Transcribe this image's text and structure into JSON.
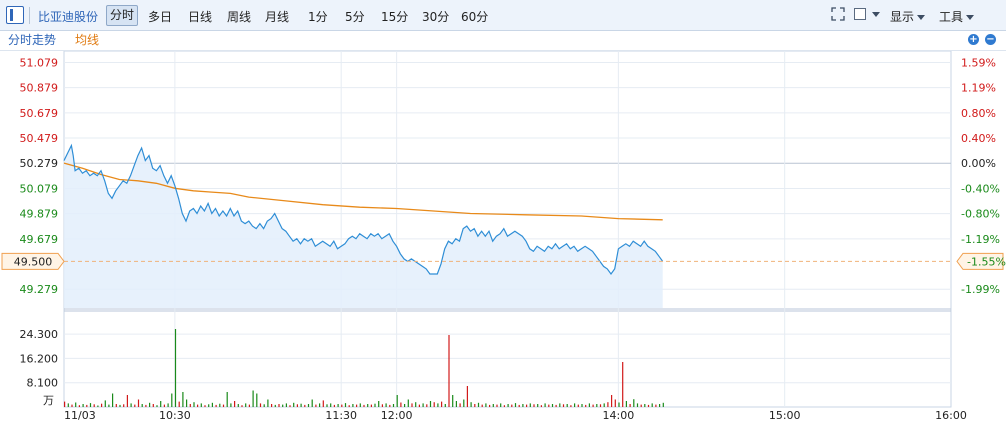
{
  "toolbar": {
    "stock_name": "比亚迪股份",
    "tabs": [
      "分时",
      "多日",
      "日线",
      "周线",
      "月线",
      "1分",
      "5分",
      "15分",
      "30分",
      "60分"
    ],
    "active_tab": "分时",
    "display_label": "显示",
    "tools_label": "工具"
  },
  "subheader": {
    "intraday_label": "分时走势",
    "avg_label": "均线"
  },
  "colors": {
    "price_line": "#2f8ed6",
    "avg_line": "#e88a1a",
    "up": "#d11a1a",
    "down": "#1a8a1a",
    "neutral": "#222222",
    "grid": "#e6ecf3"
  },
  "chart_data": {
    "type": "line",
    "prev_close": 50.279,
    "current": {
      "price": "49.500",
      "pct": "-1.55%"
    },
    "price_ticks": [
      "51.079",
      "50.879",
      "50.679",
      "50.479",
      "50.279",
      "50.079",
      "49.879",
      "49.679",
      "49.279"
    ],
    "pct_ticks": [
      "1.59%",
      "1.19%",
      "0.80%",
      "0.40%",
      "0.00%",
      "-0.40%",
      "-0.80%",
      "-1.19%",
      "-1.99%"
    ],
    "ylim": [
      49.13,
      51.17
    ],
    "time_labels": [
      "11/03",
      "10:30",
      "11:30",
      "12:00",
      "14:00",
      "15:00",
      "16:00"
    ],
    "time_minutes": [
      0,
      60,
      150,
      180,
      300,
      390,
      480
    ],
    "minutes_total": 480,
    "session_end_minute": 390,
    "price_series": [
      [
        0,
        50.3
      ],
      [
        2,
        50.36
      ],
      [
        4,
        50.42
      ],
      [
        5,
        50.34
      ],
      [
        6,
        50.22
      ],
      [
        8,
        50.24
      ],
      [
        10,
        50.2
      ],
      [
        12,
        50.22
      ],
      [
        14,
        50.18
      ],
      [
        16,
        50.2
      ],
      [
        18,
        50.18
      ],
      [
        20,
        50.22
      ],
      [
        22,
        50.14
      ],
      [
        24,
        50.04
      ],
      [
        26,
        50.0
      ],
      [
        28,
        50.06
      ],
      [
        30,
        50.1
      ],
      [
        32,
        50.14
      ],
      [
        34,
        50.12
      ],
      [
        36,
        50.18
      ],
      [
        38,
        50.26
      ],
      [
        40,
        50.34
      ],
      [
        42,
        50.4
      ],
      [
        44,
        50.3
      ],
      [
        46,
        50.34
      ],
      [
        48,
        50.24
      ],
      [
        50,
        50.22
      ],
      [
        52,
        50.26
      ],
      [
        54,
        50.18
      ],
      [
        56,
        50.12
      ],
      [
        58,
        50.18
      ],
      [
        60,
        50.1
      ],
      [
        62,
        50.0
      ],
      [
        64,
        49.88
      ],
      [
        66,
        49.82
      ],
      [
        68,
        49.9
      ],
      [
        70,
        49.92
      ],
      [
        72,
        49.88
      ],
      [
        74,
        49.94
      ],
      [
        76,
        49.9
      ],
      [
        78,
        49.96
      ],
      [
        80,
        49.88
      ],
      [
        82,
        49.92
      ],
      [
        84,
        49.86
      ],
      [
        86,
        49.9
      ],
      [
        88,
        49.86
      ],
      [
        90,
        49.92
      ],
      [
        92,
        49.86
      ],
      [
        94,
        49.9
      ],
      [
        96,
        49.82
      ],
      [
        98,
        49.8
      ],
      [
        100,
        49.82
      ],
      [
        102,
        49.78
      ],
      [
        104,
        49.76
      ],
      [
        106,
        49.8
      ],
      [
        108,
        49.76
      ],
      [
        110,
        49.82
      ],
      [
        112,
        49.84
      ],
      [
        114,
        49.88
      ],
      [
        116,
        49.82
      ],
      [
        118,
        49.76
      ],
      [
        120,
        49.74
      ],
      [
        122,
        49.7
      ],
      [
        124,
        49.66
      ],
      [
        126,
        49.68
      ],
      [
        128,
        49.64
      ],
      [
        130,
        49.68
      ],
      [
        132,
        49.66
      ],
      [
        134,
        49.68
      ],
      [
        136,
        49.62
      ],
      [
        138,
        49.64
      ],
      [
        140,
        49.66
      ],
      [
        142,
        49.64
      ],
      [
        144,
        49.62
      ],
      [
        146,
        49.66
      ],
      [
        148,
        49.6
      ],
      [
        150,
        49.62
      ],
      [
        152,
        49.64
      ],
      [
        154,
        49.68
      ],
      [
        156,
        49.7
      ],
      [
        158,
        49.68
      ],
      [
        160,
        49.72
      ],
      [
        162,
        49.7
      ],
      [
        164,
        49.68
      ],
      [
        166,
        49.72
      ],
      [
        168,
        49.7
      ],
      [
        170,
        49.72
      ],
      [
        172,
        49.68
      ],
      [
        174,
        49.7
      ],
      [
        176,
        49.72
      ],
      [
        178,
        49.66
      ],
      [
        180,
        49.62
      ],
      [
        182,
        49.56
      ],
      [
        184,
        49.52
      ],
      [
        186,
        49.5
      ],
      [
        188,
        49.52
      ],
      [
        190,
        49.5
      ],
      [
        192,
        49.48
      ],
      [
        194,
        49.46
      ],
      [
        196,
        49.44
      ],
      [
        198,
        49.4
      ],
      [
        200,
        49.4
      ],
      [
        202,
        49.4
      ],
      [
        204,
        49.48
      ],
      [
        206,
        49.6
      ],
      [
        208,
        49.66
      ],
      [
        210,
        49.64
      ],
      [
        212,
        49.68
      ],
      [
        214,
        49.66
      ],
      [
        216,
        49.76
      ],
      [
        218,
        49.78
      ],
      [
        220,
        49.74
      ],
      [
        222,
        49.76
      ],
      [
        224,
        49.7
      ],
      [
        226,
        49.74
      ],
      [
        228,
        49.7
      ],
      [
        230,
        49.74
      ],
      [
        232,
        49.66
      ],
      [
        234,
        49.7
      ],
      [
        236,
        49.72
      ],
      [
        238,
        49.76
      ],
      [
        240,
        49.7
      ],
      [
        242,
        49.72
      ],
      [
        244,
        49.74
      ],
      [
        246,
        49.72
      ],
      [
        248,
        49.7
      ],
      [
        250,
        49.66
      ],
      [
        252,
        49.6
      ],
      [
        254,
        49.58
      ],
      [
        256,
        49.62
      ],
      [
        258,
        49.6
      ],
      [
        260,
        49.58
      ],
      [
        262,
        49.62
      ],
      [
        264,
        49.6
      ],
      [
        266,
        49.64
      ],
      [
        268,
        49.6
      ],
      [
        270,
        49.62
      ],
      [
        272,
        49.64
      ],
      [
        274,
        49.6
      ],
      [
        276,
        49.62
      ],
      [
        278,
        49.58
      ],
      [
        280,
        49.6
      ],
      [
        282,
        49.62
      ],
      [
        284,
        49.6
      ],
      [
        286,
        49.58
      ],
      [
        288,
        49.54
      ],
      [
        290,
        49.5
      ],
      [
        292,
        49.46
      ],
      [
        294,
        49.44
      ],
      [
        296,
        49.4
      ],
      [
        298,
        49.44
      ],
      [
        300,
        49.6
      ],
      [
        302,
        49.62
      ],
      [
        304,
        49.64
      ],
      [
        306,
        49.62
      ],
      [
        308,
        49.66
      ],
      [
        310,
        49.64
      ],
      [
        312,
        49.62
      ],
      [
        314,
        49.66
      ],
      [
        316,
        49.62
      ],
      [
        318,
        49.6
      ],
      [
        320,
        49.58
      ],
      [
        322,
        49.54
      ],
      [
        324,
        49.5
      ]
    ],
    "avg_series": [
      [
        0,
        50.28
      ],
      [
        10,
        50.24
      ],
      [
        20,
        50.19
      ],
      [
        30,
        50.15
      ],
      [
        40,
        50.14
      ],
      [
        50,
        50.12
      ],
      [
        60,
        50.08
      ],
      [
        70,
        50.06
      ],
      [
        80,
        50.05
      ],
      [
        90,
        50.04
      ],
      [
        100,
        50.01
      ],
      [
        120,
        49.98
      ],
      [
        140,
        49.95
      ],
      [
        160,
        49.93
      ],
      [
        180,
        49.92
      ],
      [
        200,
        49.9
      ],
      [
        220,
        49.88
      ],
      [
        250,
        49.87
      ],
      [
        280,
        49.86
      ],
      [
        300,
        49.84
      ],
      [
        324,
        49.83
      ]
    ],
    "volume_ticks": [
      "24.300",
      "16.200",
      "8.100"
    ],
    "volume_unit": "万",
    "volume_max": 27,
    "volume_series": [
      [
        0,
        1.8,
        "r"
      ],
      [
        2,
        1.2,
        "g"
      ],
      [
        4,
        0.8,
        "r"
      ],
      [
        6,
        1.5,
        "g"
      ],
      [
        8,
        0.6,
        "r"
      ],
      [
        10,
        1.0,
        "g"
      ],
      [
        12,
        0.7,
        "r"
      ],
      [
        14,
        1.3,
        "g"
      ],
      [
        16,
        0.9,
        "r"
      ],
      [
        18,
        0.5,
        "g"
      ],
      [
        20,
        1.1,
        "r"
      ],
      [
        22,
        2.2,
        "g"
      ],
      [
        24,
        0.8,
        "g"
      ],
      [
        26,
        4.5,
        "g"
      ],
      [
        28,
        1.0,
        "r"
      ],
      [
        30,
        0.7,
        "g"
      ],
      [
        32,
        0.9,
        "r"
      ],
      [
        34,
        4.0,
        "r"
      ],
      [
        36,
        1.2,
        "g"
      ],
      [
        38,
        0.8,
        "r"
      ],
      [
        40,
        2.5,
        "r"
      ],
      [
        42,
        1.0,
        "g"
      ],
      [
        44,
        0.7,
        "r"
      ],
      [
        46,
        1.4,
        "g"
      ],
      [
        48,
        1.0,
        "r"
      ],
      [
        50,
        0.6,
        "g"
      ],
      [
        52,
        2.0,
        "g"
      ],
      [
        54,
        0.8,
        "r"
      ],
      [
        56,
        1.2,
        "g"
      ],
      [
        58,
        4.5,
        "g"
      ],
      [
        60,
        26.0,
        "g"
      ],
      [
        62,
        1.8,
        "r"
      ],
      [
        64,
        5.0,
        "g"
      ],
      [
        66,
        2.5,
        "g"
      ],
      [
        68,
        1.0,
        "r"
      ],
      [
        70,
        1.6,
        "g"
      ],
      [
        72,
        0.8,
        "r"
      ],
      [
        74,
        1.2,
        "g"
      ],
      [
        76,
        0.6,
        "r"
      ],
      [
        78,
        0.9,
        "g"
      ],
      [
        80,
        1.4,
        "g"
      ],
      [
        82,
        0.7,
        "r"
      ],
      [
        84,
        1.1,
        "g"
      ],
      [
        86,
        0.8,
        "r"
      ],
      [
        88,
        5.0,
        "g"
      ],
      [
        90,
        1.2,
        "g"
      ],
      [
        92,
        2.0,
        "r"
      ],
      [
        94,
        1.0,
        "g"
      ],
      [
        96,
        0.6,
        "r"
      ],
      [
        98,
        1.2,
        "g"
      ],
      [
        100,
        0.8,
        "r"
      ],
      [
        102,
        5.5,
        "g"
      ],
      [
        104,
        4.5,
        "g"
      ],
      [
        106,
        1.2,
        "r"
      ],
      [
        108,
        0.9,
        "g"
      ],
      [
        110,
        2.5,
        "g"
      ],
      [
        112,
        1.0,
        "r"
      ],
      [
        114,
        0.7,
        "g"
      ],
      [
        116,
        1.0,
        "r"
      ],
      [
        118,
        0.8,
        "g"
      ],
      [
        120,
        1.2,
        "g"
      ],
      [
        122,
        0.6,
        "r"
      ],
      [
        124,
        1.4,
        "g"
      ],
      [
        126,
        0.9,
        "r"
      ],
      [
        128,
        1.1,
        "g"
      ],
      [
        130,
        0.7,
        "r"
      ],
      [
        132,
        1.0,
        "g"
      ],
      [
        134,
        2.5,
        "g"
      ],
      [
        136,
        0.8,
        "r"
      ],
      [
        138,
        1.2,
        "g"
      ],
      [
        140,
        2.2,
        "r"
      ],
      [
        142,
        0.9,
        "g"
      ],
      [
        144,
        1.2,
        "g"
      ],
      [
        146,
        0.7,
        "r"
      ],
      [
        148,
        1.0,
        "g"
      ],
      [
        150,
        0.8,
        "r"
      ],
      [
        152,
        1.3,
        "g"
      ],
      [
        154,
        0.6,
        "r"
      ],
      [
        156,
        1.0,
        "g"
      ],
      [
        158,
        0.8,
        "r"
      ],
      [
        160,
        1.2,
        "g"
      ],
      [
        162,
        0.7,
        "r"
      ],
      [
        164,
        1.0,
        "g"
      ],
      [
        166,
        0.8,
        "r"
      ],
      [
        168,
        1.1,
        "g"
      ],
      [
        170,
        2.0,
        "g"
      ],
      [
        172,
        0.9,
        "r"
      ],
      [
        174,
        1.2,
        "g"
      ],
      [
        176,
        0.7,
        "r"
      ],
      [
        178,
        1.0,
        "g"
      ],
      [
        180,
        4.0,
        "g"
      ],
      [
        182,
        1.5,
        "r"
      ],
      [
        184,
        1.0,
        "g"
      ],
      [
        186,
        2.5,
        "g"
      ],
      [
        188,
        1.2,
        "r"
      ],
      [
        190,
        1.6,
        "g"
      ],
      [
        192,
        0.8,
        "r"
      ],
      [
        194,
        1.2,
        "g"
      ],
      [
        196,
        0.9,
        "r"
      ],
      [
        198,
        2.0,
        "g"
      ],
      [
        200,
        1.6,
        "r"
      ],
      [
        202,
        1.2,
        "g"
      ],
      [
        204,
        1.8,
        "r"
      ],
      [
        206,
        1.0,
        "g"
      ],
      [
        208,
        24.0,
        "r"
      ],
      [
        210,
        4.0,
        "g"
      ],
      [
        212,
        2.0,
        "g"
      ],
      [
        214,
        1.2,
        "r"
      ],
      [
        216,
        2.5,
        "g"
      ],
      [
        218,
        7.0,
        "r"
      ],
      [
        220,
        1.6,
        "g"
      ],
      [
        222,
        1.0,
        "r"
      ],
      [
        224,
        1.4,
        "g"
      ],
      [
        226,
        0.8,
        "r"
      ],
      [
        228,
        1.2,
        "g"
      ],
      [
        230,
        0.7,
        "r"
      ],
      [
        232,
        1.0,
        "g"
      ],
      [
        234,
        0.8,
        "r"
      ],
      [
        236,
        1.2,
        "g"
      ],
      [
        238,
        0.6,
        "r"
      ],
      [
        240,
        1.0,
        "g"
      ],
      [
        242,
        0.8,
        "r"
      ],
      [
        244,
        1.3,
        "g"
      ],
      [
        246,
        0.7,
        "r"
      ],
      [
        248,
        1.0,
        "g"
      ],
      [
        250,
        0.8,
        "r"
      ],
      [
        252,
        1.2,
        "g"
      ],
      [
        254,
        0.9,
        "r"
      ],
      [
        256,
        1.0,
        "g"
      ],
      [
        258,
        0.6,
        "r"
      ],
      [
        260,
        1.2,
        "g"
      ],
      [
        262,
        0.8,
        "r"
      ],
      [
        264,
        1.0,
        "g"
      ],
      [
        266,
        0.7,
        "r"
      ],
      [
        268,
        1.2,
        "g"
      ],
      [
        270,
        0.9,
        "r"
      ],
      [
        272,
        1.0,
        "g"
      ],
      [
        274,
        0.6,
        "r"
      ],
      [
        276,
        1.2,
        "g"
      ],
      [
        278,
        0.8,
        "r"
      ],
      [
        280,
        1.0,
        "g"
      ],
      [
        282,
        0.7,
        "r"
      ],
      [
        284,
        1.2,
        "g"
      ],
      [
        286,
        0.8,
        "r"
      ],
      [
        288,
        1.0,
        "g"
      ],
      [
        290,
        0.9,
        "r"
      ],
      [
        292,
        1.2,
        "g"
      ],
      [
        294,
        1.6,
        "r"
      ],
      [
        296,
        4.0,
        "r"
      ],
      [
        298,
        2.5,
        "r"
      ],
      [
        300,
        1.5,
        "g"
      ],
      [
        302,
        15.0,
        "r"
      ],
      [
        304,
        2.0,
        "g"
      ],
      [
        306,
        1.0,
        "r"
      ],
      [
        308,
        2.6,
        "g"
      ],
      [
        310,
        1.2,
        "g"
      ],
      [
        312,
        0.8,
        "r"
      ],
      [
        314,
        1.0,
        "g"
      ],
      [
        316,
        0.7,
        "r"
      ],
      [
        318,
        1.2,
        "g"
      ],
      [
        320,
        0.8,
        "r"
      ],
      [
        322,
        1.0,
        "g"
      ],
      [
        324,
        1.4,
        "g"
      ]
    ]
  }
}
